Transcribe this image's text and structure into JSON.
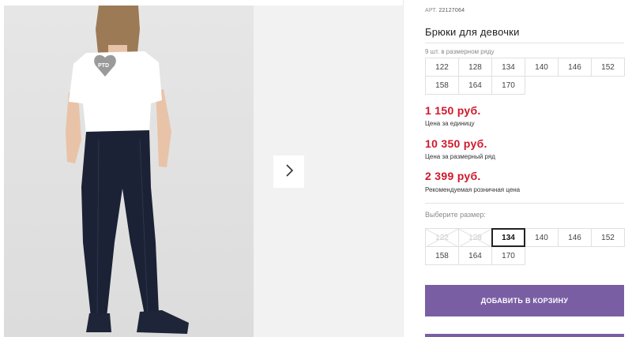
{
  "gallery": {
    "main_image_alt": "",
    "next_icon": "chevron-right-icon",
    "shirt_logo": "PTD"
  },
  "product": {
    "art_prefix": "АРТ.",
    "art_number": "22127064",
    "title": "Брюки для девочки"
  },
  "size_row": {
    "note": "9 шт. в размерном ряду",
    "sizes": [
      "122",
      "128",
      "134",
      "140",
      "146",
      "152",
      "158",
      "164",
      "170"
    ]
  },
  "prices": {
    "unit_price": "1 150 руб.",
    "unit_label": "Цена за единицу",
    "row_price": "10 350 руб.",
    "row_label": "Цена за размерный ряд",
    "retail_price": "2 399 руб.",
    "retail_label": "Рекомендуемая розничная цена"
  },
  "size_picker": {
    "label": "Выберите размер:",
    "sizes": [
      {
        "label": "122",
        "state": "disabled"
      },
      {
        "label": "128",
        "state": "disabled"
      },
      {
        "label": "134",
        "state": "selected"
      },
      {
        "label": "140",
        "state": "available"
      },
      {
        "label": "146",
        "state": "available"
      },
      {
        "label": "152",
        "state": "available"
      },
      {
        "label": "158",
        "state": "available"
      },
      {
        "label": "164",
        "state": "available"
      },
      {
        "label": "170",
        "state": "available"
      }
    ]
  },
  "actions": {
    "add_to_cart": "ДОБАВИТЬ В КОРЗИНУ"
  },
  "colors": {
    "price": "#d0182b",
    "button": "#7a5ea4",
    "pants": "#1b2235",
    "shirt": "#ffffff"
  }
}
